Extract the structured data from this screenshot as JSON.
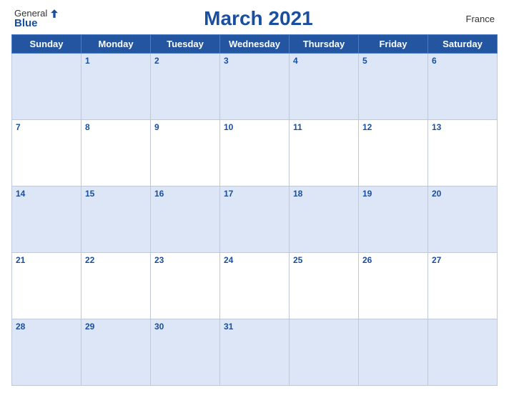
{
  "header": {
    "logo_general": "General",
    "logo_blue": "Blue",
    "title": "March 2021",
    "country": "France"
  },
  "weekdays": [
    "Sunday",
    "Monday",
    "Tuesday",
    "Wednesday",
    "Thursday",
    "Friday",
    "Saturday"
  ],
  "weeks": [
    [
      {
        "day": "",
        "empty": true
      },
      {
        "day": "1",
        "empty": false
      },
      {
        "day": "2",
        "empty": false
      },
      {
        "day": "3",
        "empty": false
      },
      {
        "day": "4",
        "empty": false
      },
      {
        "day": "5",
        "empty": false
      },
      {
        "day": "6",
        "empty": false
      }
    ],
    [
      {
        "day": "7",
        "empty": false
      },
      {
        "day": "8",
        "empty": false
      },
      {
        "day": "9",
        "empty": false
      },
      {
        "day": "10",
        "empty": false
      },
      {
        "day": "11",
        "empty": false
      },
      {
        "day": "12",
        "empty": false
      },
      {
        "day": "13",
        "empty": false
      }
    ],
    [
      {
        "day": "14",
        "empty": false
      },
      {
        "day": "15",
        "empty": false
      },
      {
        "day": "16",
        "empty": false
      },
      {
        "day": "17",
        "empty": false
      },
      {
        "day": "18",
        "empty": false
      },
      {
        "day": "19",
        "empty": false
      },
      {
        "day": "20",
        "empty": false
      }
    ],
    [
      {
        "day": "21",
        "empty": false
      },
      {
        "day": "22",
        "empty": false
      },
      {
        "day": "23",
        "empty": false
      },
      {
        "day": "24",
        "empty": false
      },
      {
        "day": "25",
        "empty": false
      },
      {
        "day": "26",
        "empty": false
      },
      {
        "day": "27",
        "empty": false
      }
    ],
    [
      {
        "day": "28",
        "empty": false
      },
      {
        "day": "29",
        "empty": false
      },
      {
        "day": "30",
        "empty": false
      },
      {
        "day": "31",
        "empty": false
      },
      {
        "day": "",
        "empty": true
      },
      {
        "day": "",
        "empty": true
      },
      {
        "day": "",
        "empty": true
      }
    ]
  ],
  "row_styles": [
    "blue",
    "white",
    "blue",
    "white",
    "blue"
  ]
}
